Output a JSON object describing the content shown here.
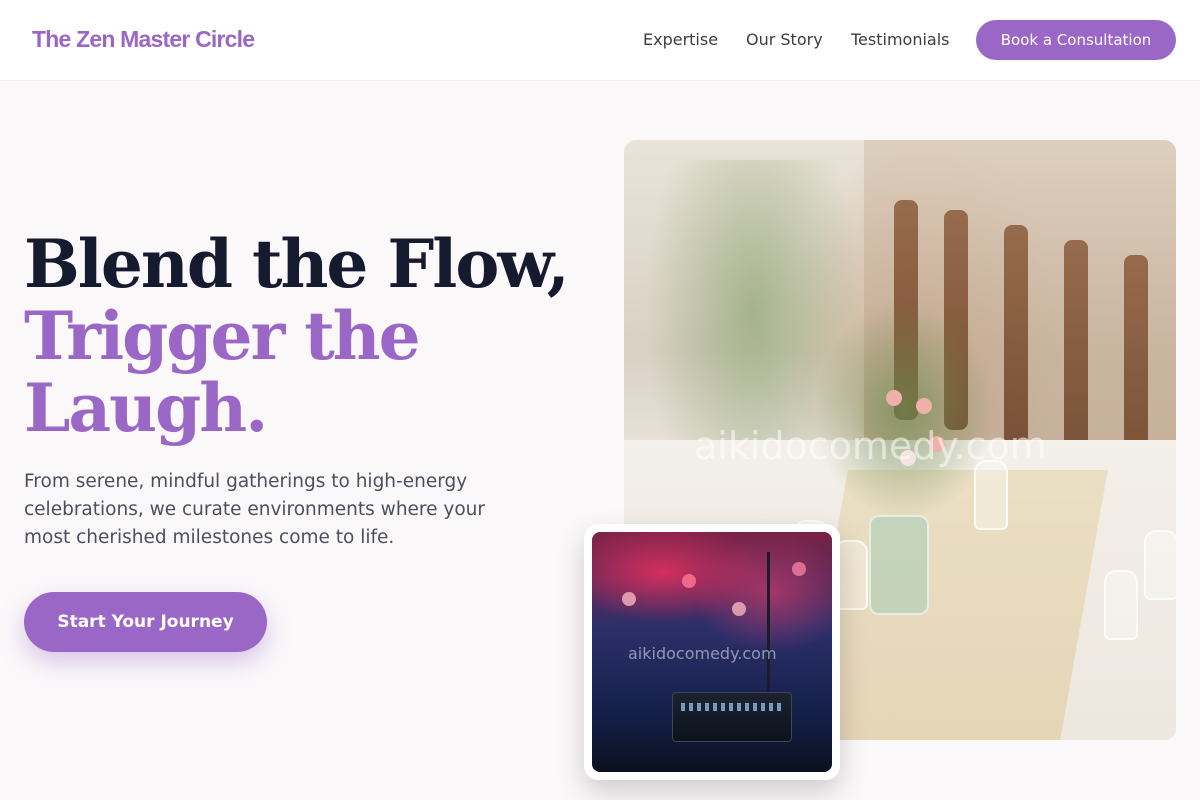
{
  "nav": {
    "logo": "The Zen Master Circle",
    "links": [
      "Expertise",
      "Our Story",
      "Testimonials"
    ],
    "cta_label": "Book a Consultation"
  },
  "hero": {
    "headline_line1": "Blend the Flow,",
    "headline_line2": "Trigger the Laugh.",
    "subtext": "From serene, mindful gatherings to high-energy celebrations, we curate environments where your most cherished milestones come to life.",
    "cta_label": "Start Your Journey",
    "image_watermark": "aikidocomedy.com",
    "inset_watermark": "aikidocomedy.com"
  },
  "colors": {
    "accent": "#9b67c7",
    "heading": "#151a2e",
    "body_text": "#4b4f5c",
    "page_bg": "#fbf8fa"
  }
}
